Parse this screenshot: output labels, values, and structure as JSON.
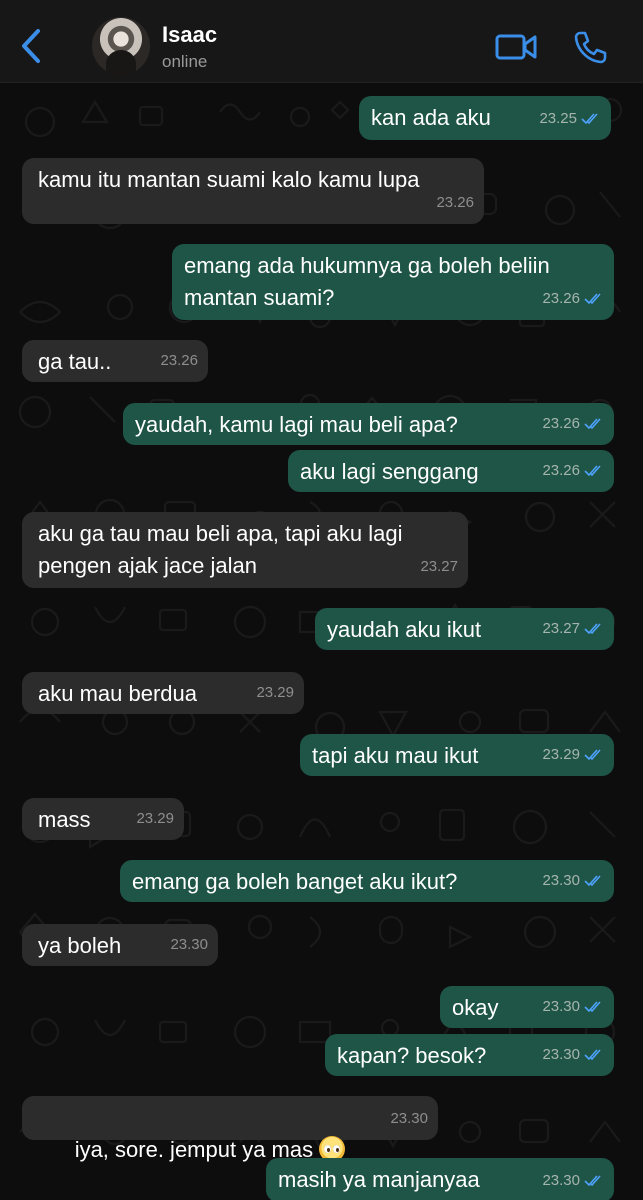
{
  "contact": {
    "name": "Isaac",
    "status": "online"
  },
  "icons": {
    "back": "chevron-left-icon",
    "video": "video-camera-icon",
    "call": "phone-icon",
    "read": "double-check-icon"
  },
  "colors": {
    "accent": "#3b8ee8",
    "outgoing_bubble": "#1e5546",
    "incoming_bubble": "#2c2c2c",
    "read_ticks": "#4fa3ff"
  },
  "messages": [
    {
      "dir": "out",
      "text": "kan ada aku",
      "time": "23.25",
      "read": true
    },
    {
      "dir": "in",
      "text": "kamu itu mantan suami kalo kamu lupa",
      "time": "23.26"
    },
    {
      "dir": "out",
      "text": "emang ada hukumnya ga boleh beliin\nmantan suami?",
      "time": "23.26",
      "read": true
    },
    {
      "dir": "in",
      "text": "ga tau..",
      "time": "23.26"
    },
    {
      "dir": "out",
      "text": "yaudah, kamu lagi mau beli apa?",
      "time": "23.26",
      "read": true
    },
    {
      "dir": "out",
      "text": "aku lagi senggang",
      "time": "23.26",
      "read": true
    },
    {
      "dir": "in",
      "text": "aku ga tau mau beli apa, tapi aku lagi\npengen ajak jace jalan",
      "time": "23.27"
    },
    {
      "dir": "out",
      "text": "yaudah aku ikut",
      "time": "23.27",
      "read": true
    },
    {
      "dir": "in",
      "text": "aku mau berdua",
      "time": "23.29"
    },
    {
      "dir": "out",
      "text": "tapi aku mau ikut",
      "time": "23.29",
      "read": true
    },
    {
      "dir": "in",
      "text": "mass",
      "time": "23.29"
    },
    {
      "dir": "out",
      "text": "emang ga boleh banget aku ikut?",
      "time": "23.30",
      "read": true
    },
    {
      "dir": "in",
      "text": "ya boleh",
      "time": "23.30"
    },
    {
      "dir": "out",
      "text": "okay",
      "time": "23.30",
      "read": true
    },
    {
      "dir": "out",
      "text": "kapan? besok?",
      "time": "23.30",
      "read": true
    },
    {
      "dir": "in",
      "text": "iya, sore. jemput ya mas",
      "emoji": "pleading-face-emoji",
      "time": "23.30"
    },
    {
      "dir": "out",
      "text": "masih ya manjanyaa",
      "time": "23.30",
      "read": true
    }
  ]
}
